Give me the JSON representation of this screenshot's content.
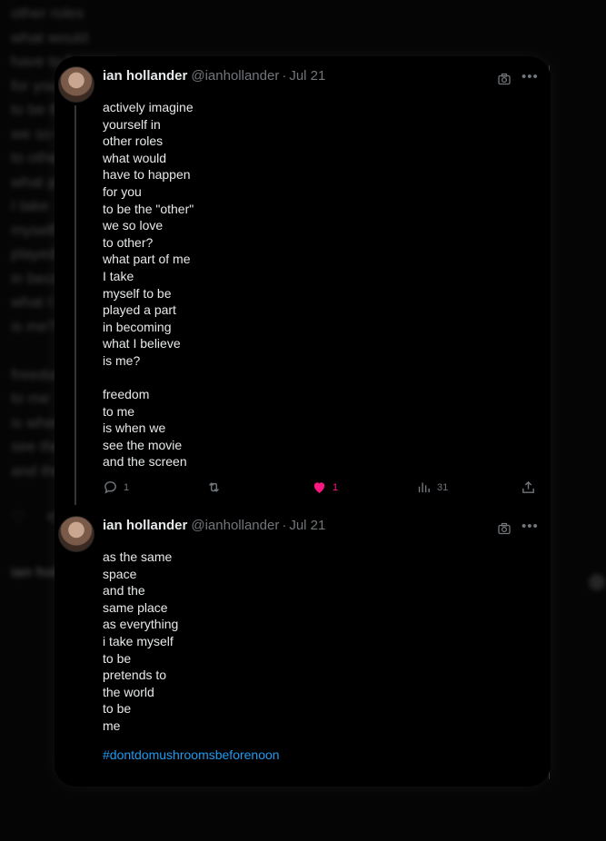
{
  "background": {
    "text_lines": [
      "other roles",
      "what would",
      "have to happen",
      "for you",
      "to be the",
      "we so love",
      "to other?",
      "what part of me",
      "I take",
      "myself to be",
      "played a part",
      "in becoming",
      "what I believe",
      "is me?",
      "",
      "freedom",
      "to me",
      "is when we",
      "see the movie",
      "and the screen"
    ],
    "name": "ian hollander"
  },
  "tweets": [
    {
      "name": "ian hollander",
      "handle": "@ianhollander",
      "separator": "·",
      "date": "Jul 21",
      "lines": [
        "actively imagine",
        "yourself in",
        "other roles",
        "what would",
        "have to happen",
        "for you",
        "to be the \"other\"",
        "we so love",
        "to other?",
        "what part of me",
        "I take",
        "myself to be",
        "played a part",
        "in becoming",
        "what I believe",
        "is me?",
        "",
        "freedom",
        "to me",
        "is when we",
        "see the movie",
        "and the screen"
      ],
      "replies": "1",
      "likes": "1",
      "views": "31"
    },
    {
      "name": "ian hollander",
      "handle": "@ianhollander",
      "separator": "·",
      "date": "Jul 21",
      "lines": [
        "as the same",
        "space",
        "and the",
        "same place",
        "as everything",
        "i take myself",
        "to be",
        "pretends to",
        "the world",
        "to be",
        "me",
        ""
      ],
      "hashtag": "#dontdomushroomsbeforenoon"
    }
  ],
  "icons": {
    "camera": "camera-icon",
    "more": "more-icon",
    "reply": "reply-icon",
    "retweet": "retweet-icon",
    "like": "heart-icon",
    "views": "views-icon",
    "share": "share-icon"
  },
  "colors": {
    "like_active": "#f91880",
    "hashtag": "#1d9bf0",
    "muted": "#71767b"
  }
}
